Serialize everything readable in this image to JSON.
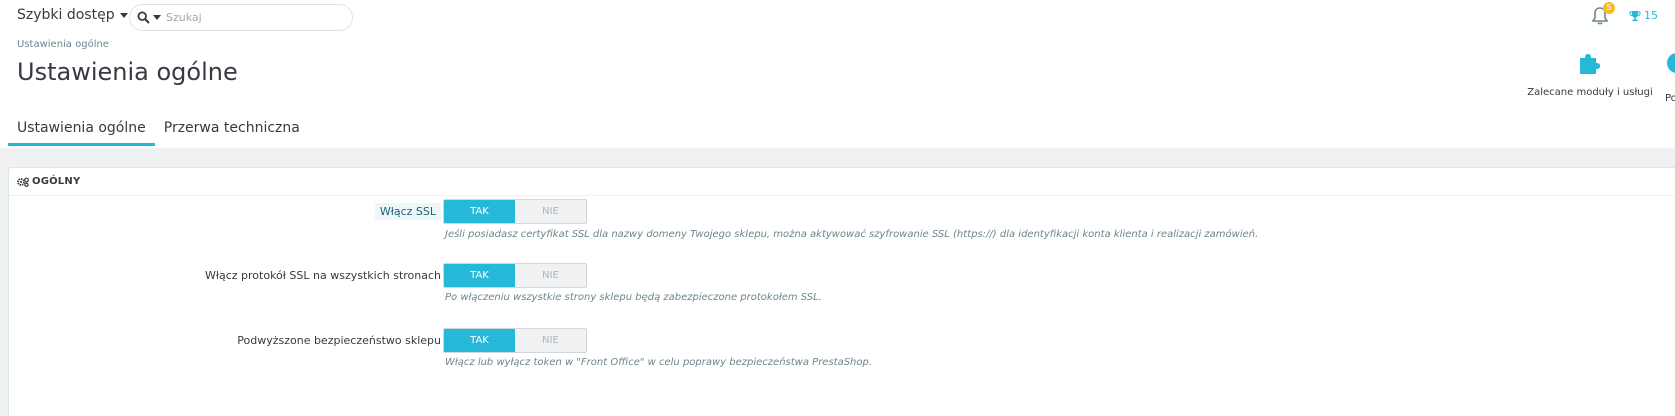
{
  "header": {
    "quick_access": "Szybki dostęp",
    "search_placeholder": "Szukaj",
    "notifications_count": "5",
    "trophy_count": "15"
  },
  "breadcrumb": "Ustawienia ogólne",
  "page_title": "Ustawienia ogólne",
  "toolbar": {
    "recommended_label": "Zalecane moduły i usługi",
    "cut_label": "Po"
  },
  "tabs": [
    {
      "label": "Ustawienia ogólne",
      "active": true
    },
    {
      "label": "Przerwa techniczna",
      "active": false
    }
  ],
  "panel": {
    "heading": "OGÓLNY",
    "rows": [
      {
        "label": "Włącz SSL",
        "on": "TAK",
        "off": "NIE",
        "help": "Jeśli posiadasz certyfikat SSL dla nazwy domeny Twojego sklepu, można aktywować szyfrowanie SSL (https://) dla identyfikacji konta klienta i realizacji zamówień."
      },
      {
        "label": "Włącz protokół SSL na wszystkich stronach",
        "on": "TAK",
        "off": "NIE",
        "help": "Po włączeniu wszystkie strony sklepu będą zabezpieczone protokołem SSL."
      },
      {
        "label": "Podwyższone bezpieczeństwo sklepu",
        "on": "TAK",
        "off": "NIE",
        "help": "Włącz lub wyłącz token w \"Front Office\" w celu poprawy bezpieczeństwa PrestaShop."
      }
    ]
  },
  "colors": {
    "accent": "#25b9d7",
    "badge": "#fbbb22",
    "background": "#eff1f2"
  }
}
